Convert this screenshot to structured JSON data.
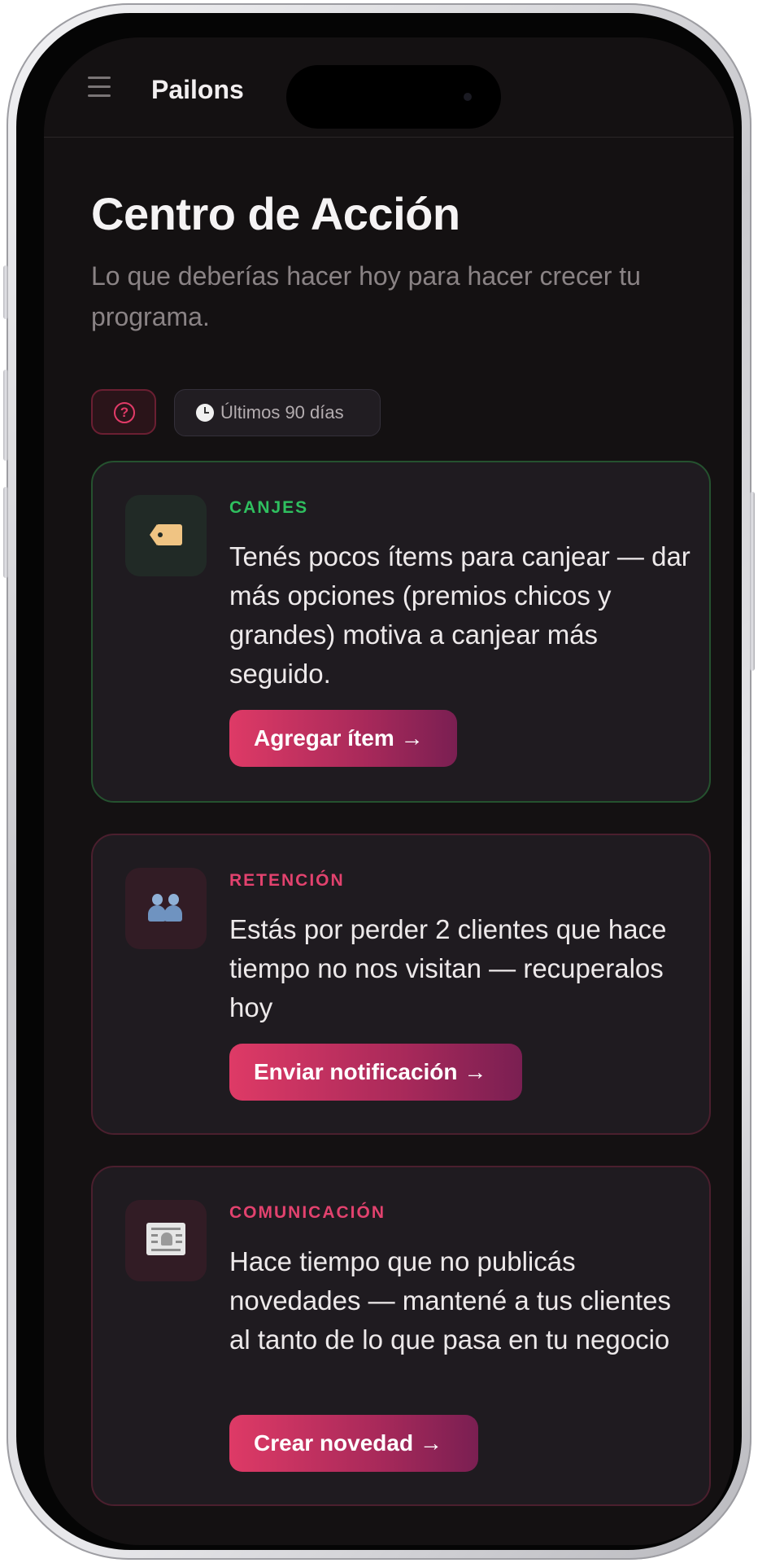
{
  "app": {
    "name": "Pailons"
  },
  "page": {
    "title": "Centro de Acción",
    "subtitle": "Lo que deberías hacer hoy para hacer crecer tu programa."
  },
  "toolbar": {
    "help_glyph": "?",
    "period_label": "Últimos 90 días"
  },
  "cards": [
    {
      "category": "CANJES",
      "icon": "tag-icon",
      "message": "Tenés pocos ítems para canjear — dar más opciones (premios chicos y grandes) motiva a canjear más seguido.",
      "action": "Agregar ítem →",
      "accent": "#2fbf5f"
    },
    {
      "category": "RETENCIÓN",
      "icon": "people-icon",
      "message": "Estás por perder 2 clientes que hace tiempo no nos visitan — recuperalos hoy",
      "action": "Enviar notificación →",
      "accent": "#e2426e"
    },
    {
      "category": "COMUNICACIÓN",
      "icon": "newspaper-icon",
      "message": "Hace tiempo que no publicás novedades — mantené a tus clientes al tanto de lo que pasa en tu negocio",
      "action": "Crear novedad →",
      "accent": "#e2426e"
    }
  ],
  "colors": {
    "background": "#141112",
    "card": "#1f1b20",
    "primary_gradient_start": "#de3a66",
    "primary_gradient_end": "#7a1f52"
  }
}
